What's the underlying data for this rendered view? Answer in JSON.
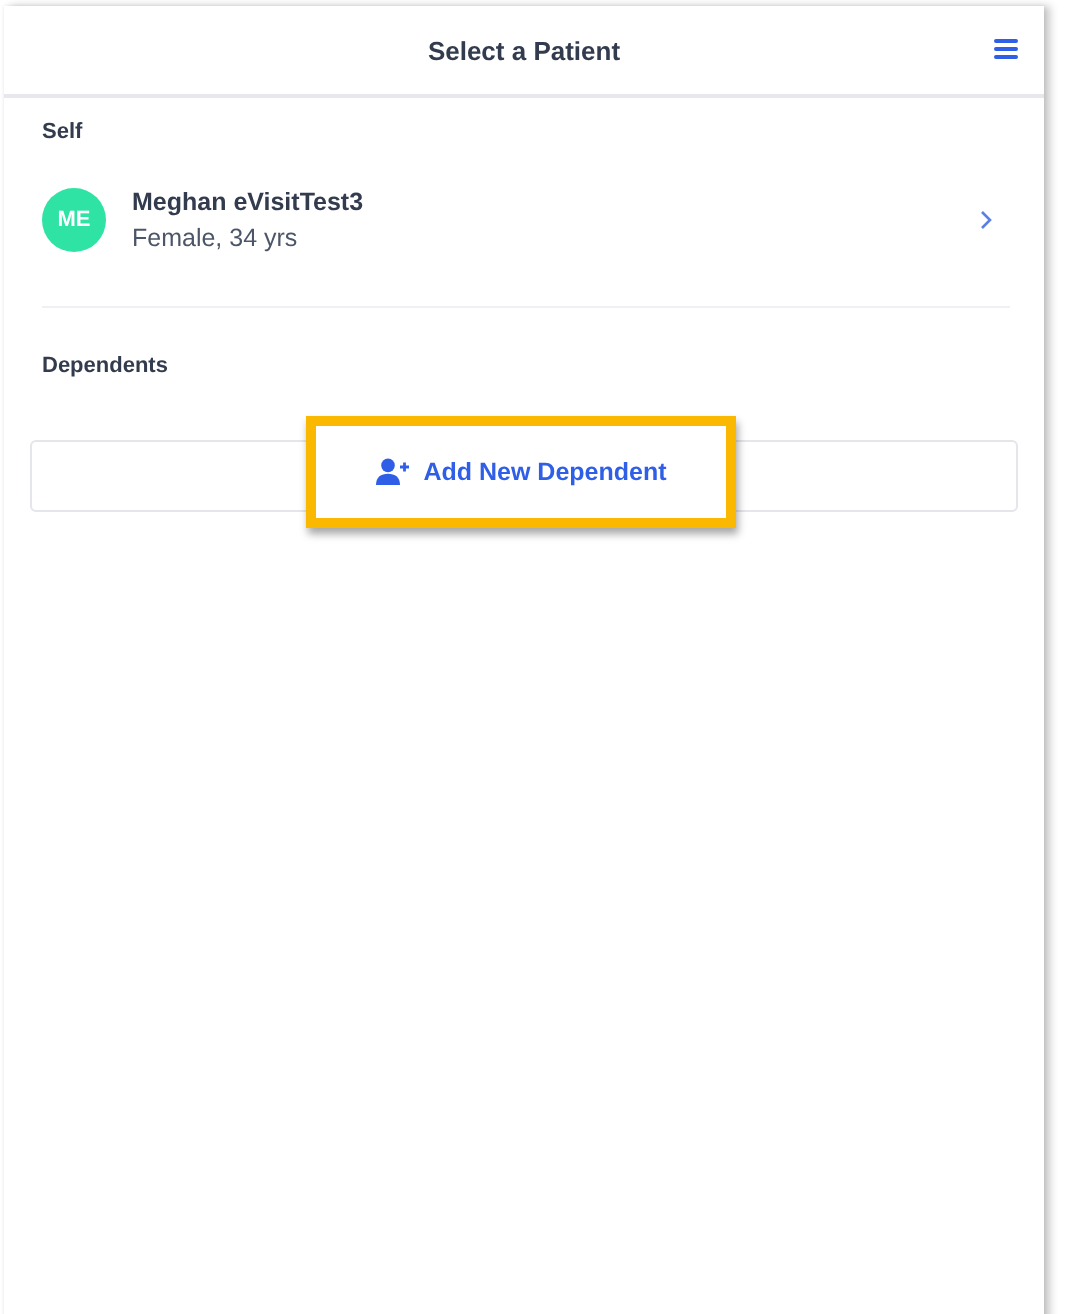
{
  "header": {
    "title": "Select a Patient"
  },
  "self_section": {
    "label": "Self",
    "patient": {
      "initials": "ME",
      "name": "Meghan eVisitTest3",
      "details": "Female, 34 yrs"
    }
  },
  "dependents_section": {
    "label": "Dependents",
    "add_button": {
      "label": "Add New Dependent",
      "highlighted": true
    }
  }
}
